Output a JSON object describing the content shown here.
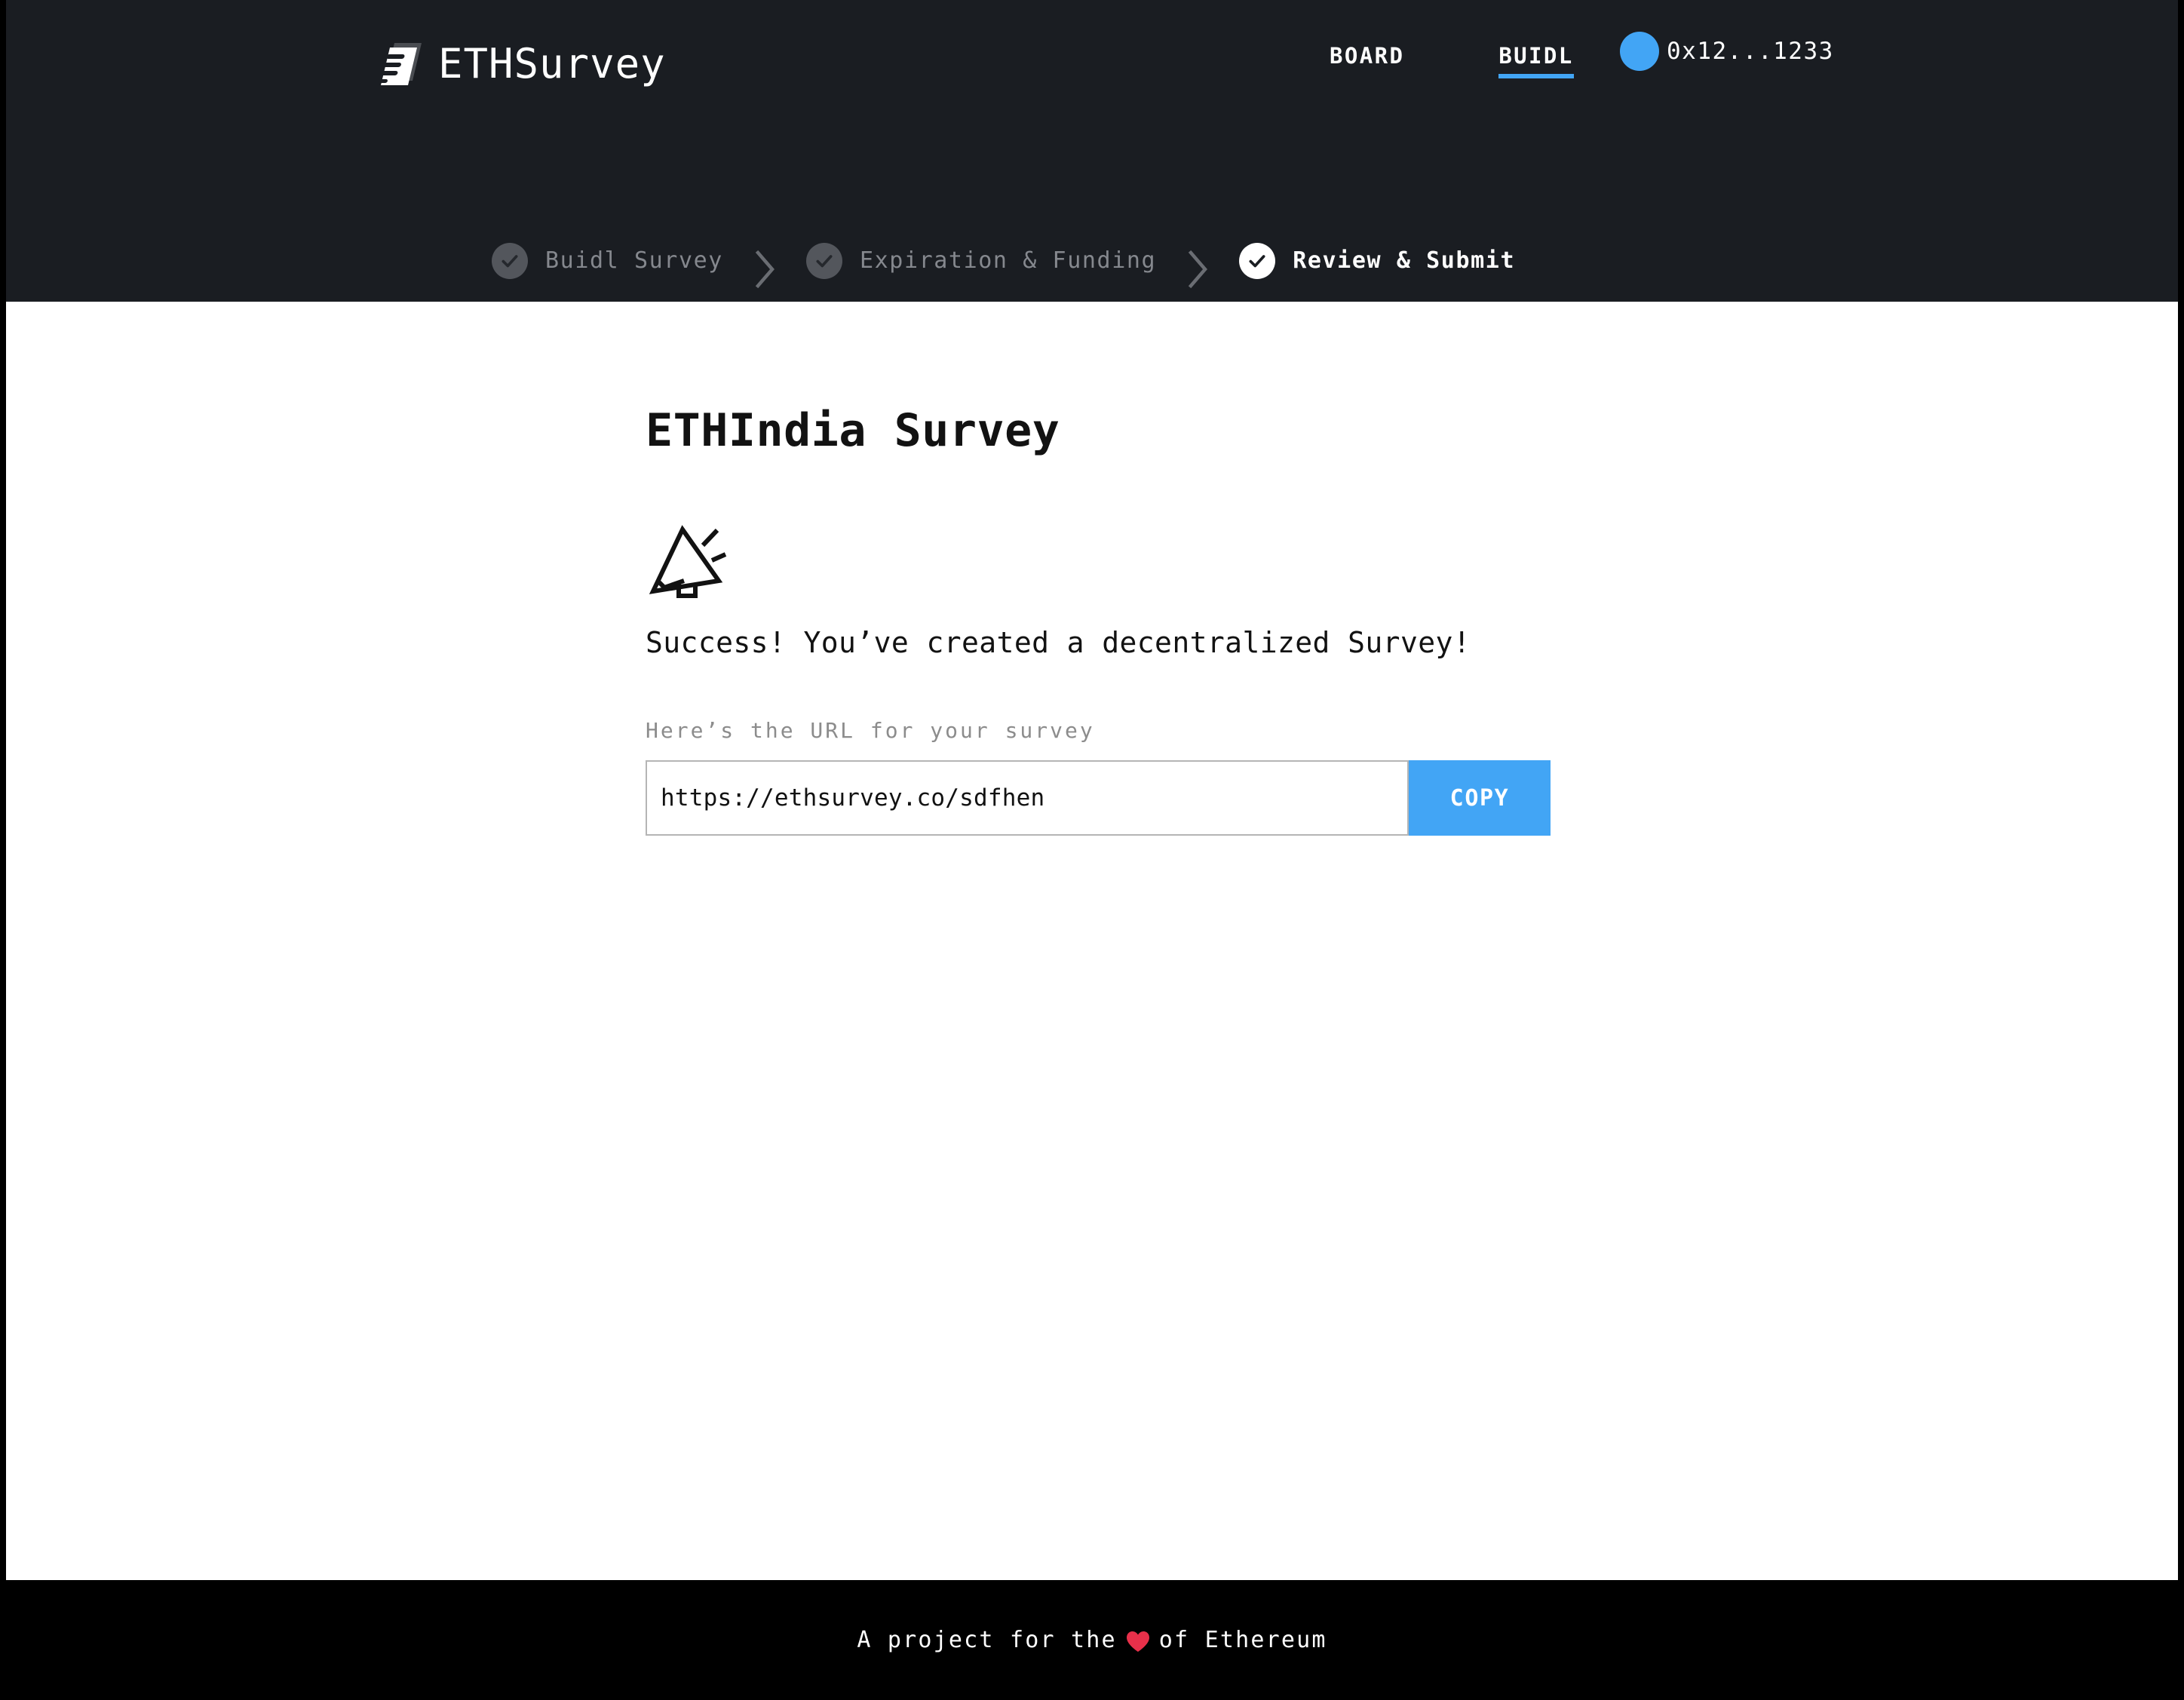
{
  "brand": {
    "name": "ETHSurvey",
    "logo_icon": "document-icon"
  },
  "nav": {
    "items": [
      {
        "label": "BOARD",
        "active": false
      },
      {
        "label": "BUIDL",
        "active": true
      }
    ],
    "wallet": {
      "address": "0x12...1233",
      "avatar_color": "#42a5f5"
    }
  },
  "stepper": {
    "steps": [
      {
        "label": "Buidl Survey",
        "state": "complete",
        "icon": "check-icon"
      },
      {
        "label": "Expiration & Funding",
        "state": "complete",
        "icon": "check-icon"
      },
      {
        "label": "Review & Submit",
        "state": "active",
        "icon": "check-icon"
      }
    ],
    "separator_icon": "chevron-right-icon"
  },
  "main": {
    "title": "ETHIndia Survey",
    "hero_icon": "megaphone-icon",
    "success_message": "Success! You’ve created a decentralized Survey!",
    "url_label": "Here’s the URL for your survey",
    "url_value": "https://ethsurvey.co/sdfhen",
    "url_placeholder": "https://ethsurvey.co/",
    "copy_label": "COPY"
  },
  "footer": {
    "text_before": "A project for the",
    "heart_icon": "heart-icon",
    "text_after": "of Ethereum"
  },
  "colors": {
    "header_bg": "#1a1d22",
    "accent": "#42a5f5",
    "footer_bg": "#000000",
    "heart": "#e8304a",
    "muted_text": "#85888e"
  }
}
